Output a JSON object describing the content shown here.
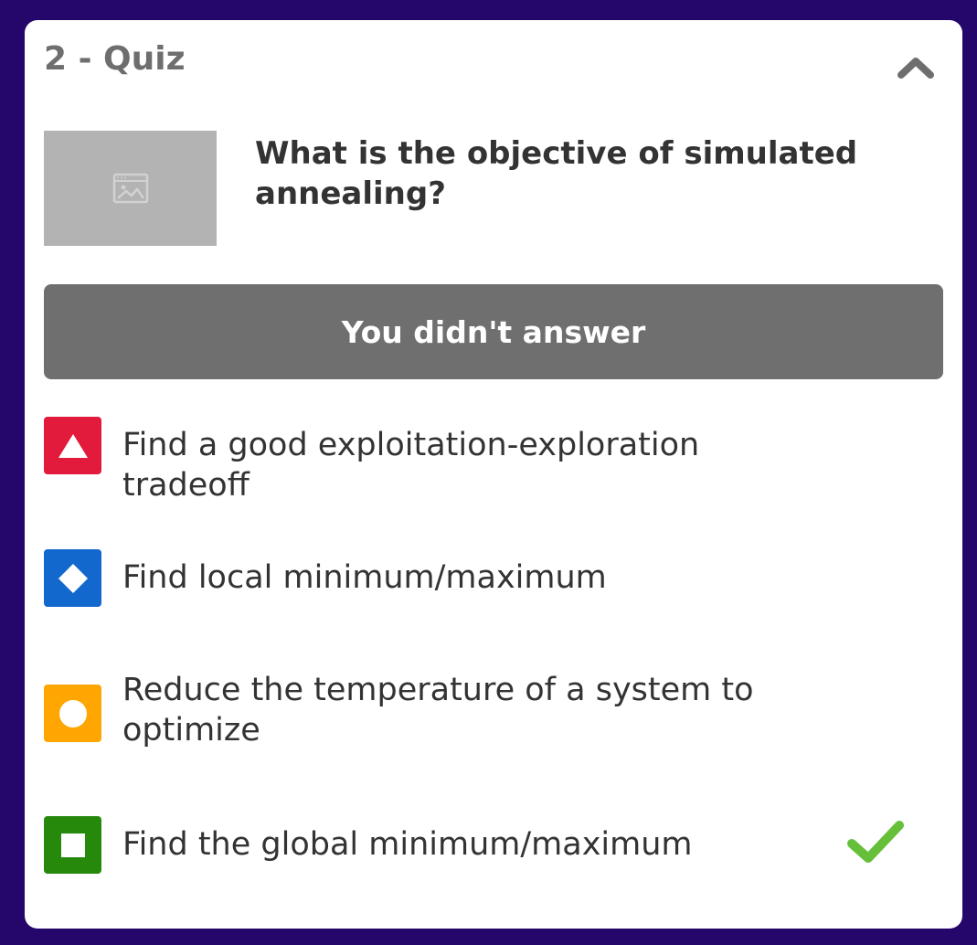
{
  "quiz": {
    "title": "2 - Quiz",
    "question": "What is the objective of simulated annealing?",
    "status": "You didn't answer",
    "collapse_icon": "chevron-up-icon",
    "image_placeholder_icon": "image-placeholder-icon",
    "answers": [
      {
        "text": "Find a good exploitation-exploration tradeoff",
        "shape": "triangle",
        "color": "#e21b3c",
        "correct": false
      },
      {
        "text": "Find local minimum/maximum",
        "shape": "diamond",
        "color": "#1368ce",
        "correct": false
      },
      {
        "text": "Reduce the temperature of a system to optimize",
        "shape": "circle",
        "color": "#ffa602",
        "correct": false
      },
      {
        "text": "Find the global minimum/maximum",
        "shape": "square",
        "color": "#26890c",
        "correct": true
      }
    ],
    "correct_icon": "checkmark-icon",
    "colors": {
      "background": "#25076b",
      "status_bar": "#6f6f6f",
      "check": "#66bf39"
    }
  }
}
